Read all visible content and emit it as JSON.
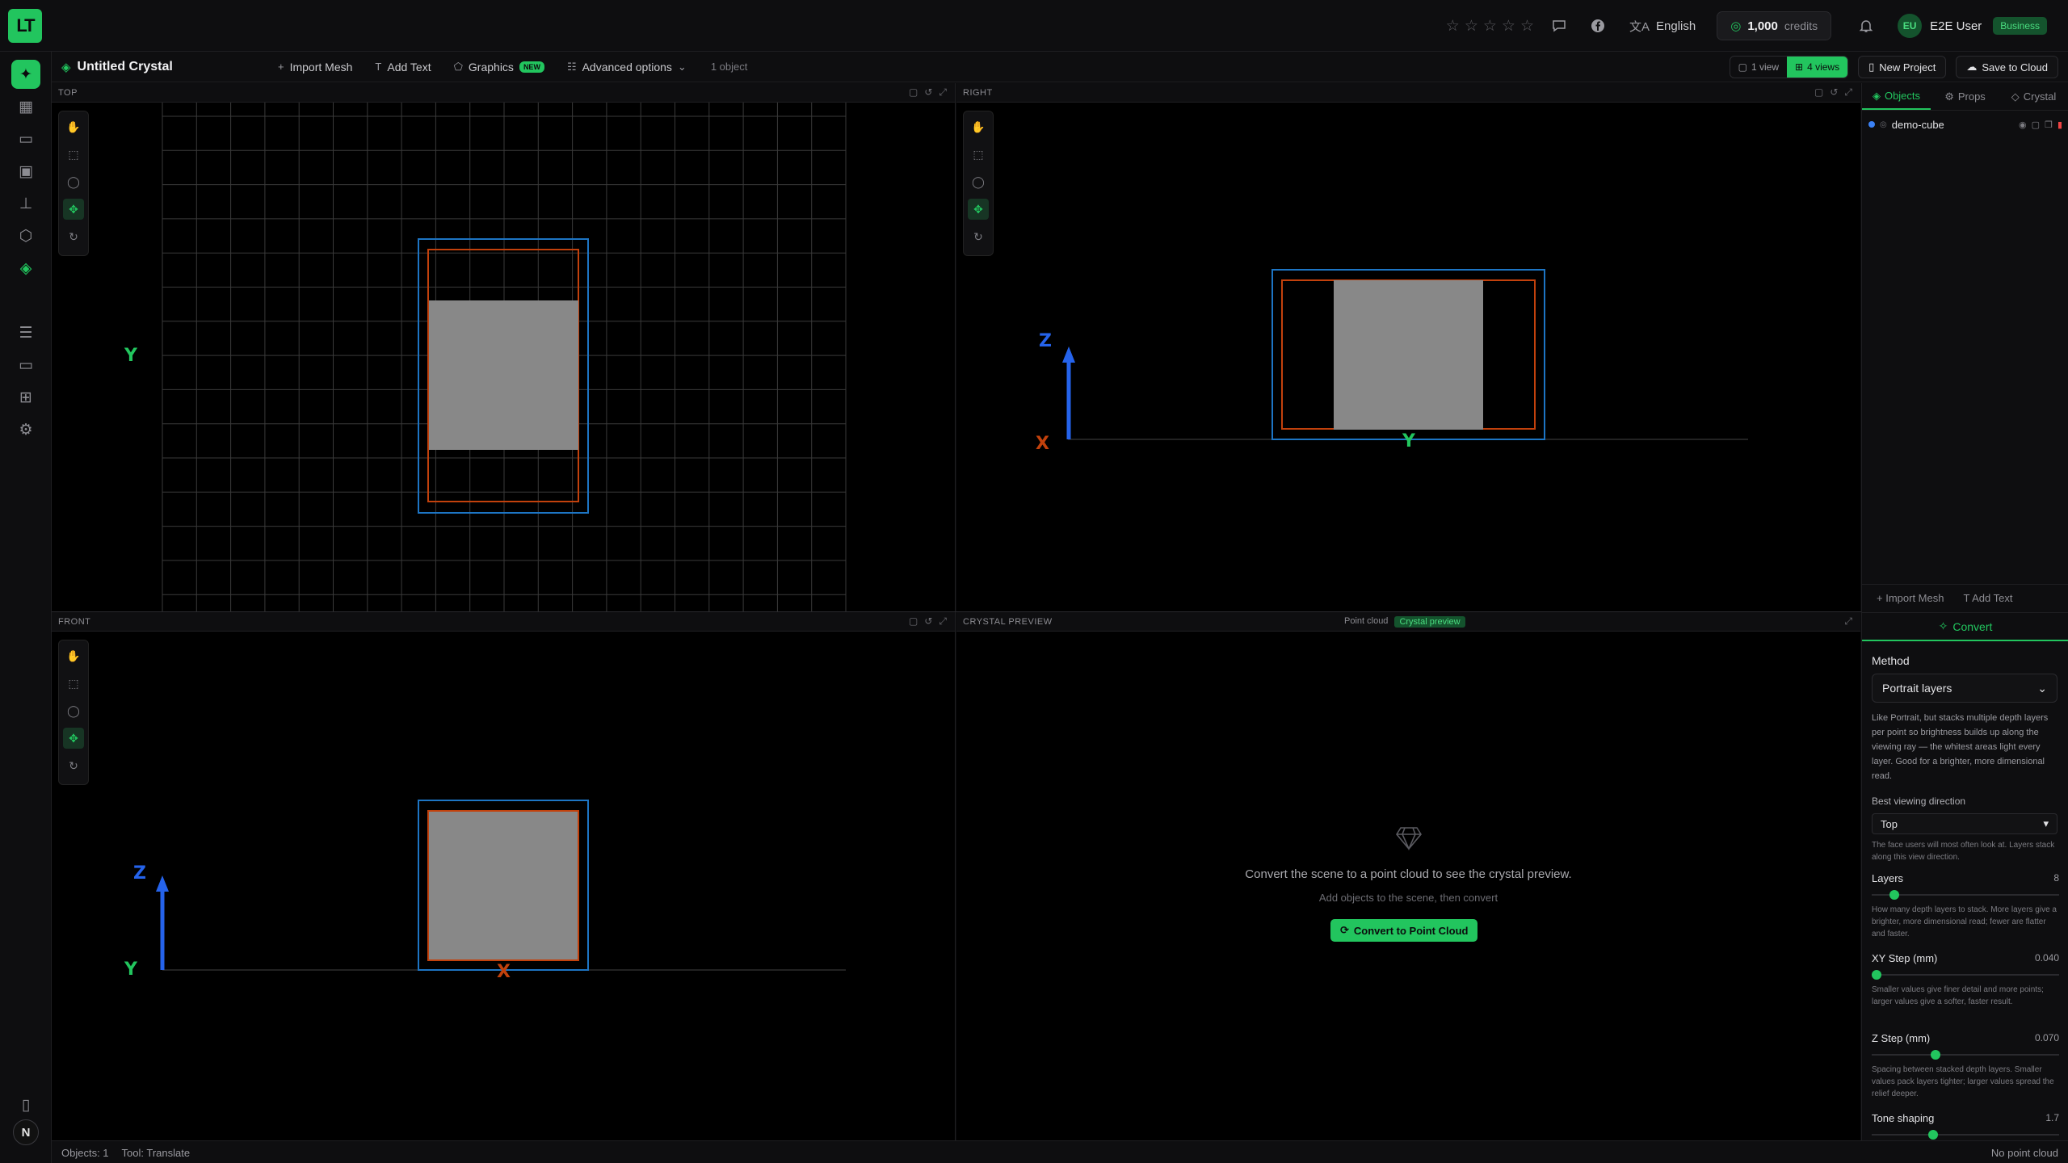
{
  "app": {
    "logo_text": "LT"
  },
  "topbar": {
    "stars": [
      "☆",
      "☆",
      "☆",
      "☆",
      "☆"
    ],
    "language": "English",
    "credits_value": "1,000",
    "credits_label": "credits",
    "user_initials": "EU",
    "user_name": "E2E User",
    "plan": "Business"
  },
  "toolbar": {
    "project_title": "Untitled Crystal",
    "import_mesh": "Import Mesh",
    "add_text": "Add Text",
    "graphics": "Graphics",
    "new_badge": "NEW",
    "advanced": "Advanced options",
    "object_count": "1 object",
    "view_one": "1 view",
    "view_four": "4 views",
    "new_project": "New Project",
    "save_cloud": "Save to Cloud"
  },
  "viewports": {
    "top": {
      "label": "TOP",
      "axis_y": "Y"
    },
    "right": {
      "label": "RIGHT",
      "axis_z": "Z",
      "axis_x": "X",
      "axis_y": "Y"
    },
    "front": {
      "label": "FRONT",
      "axis_z": "Z",
      "axis_y": "Y",
      "axis_x": "X"
    },
    "crystal": {
      "label": "CRYSTAL PREVIEW",
      "toggle_a": "Point cloud",
      "toggle_b": "Crystal preview",
      "message": "Convert the scene to a point cloud to see the crystal preview.",
      "sub": "Add objects to the scene, then convert",
      "button": "Convert to Point Cloud"
    }
  },
  "panel": {
    "tabs": [
      "Objects",
      "Props",
      "Crystal"
    ],
    "object_name": "demo-cube",
    "import_mesh": "Import Mesh",
    "add_text": "Add Text",
    "convert": "Convert",
    "method_title": "Method",
    "method_value": "Portrait layers",
    "method_desc": "Like Portrait, but stacks multiple depth layers per point so brightness builds up along the viewing ray — the whitest areas light every layer. Good for a brighter, more dimensional read.",
    "view_dir_title": "Best viewing direction",
    "view_dir_value": "Top",
    "view_dir_desc": "The face users will most often look at. Layers stack along this view direction.",
    "layers_title": "Layers",
    "layers_value": "8",
    "layers_fraction": 0.1,
    "layers_desc": "How many depth layers to stack. More layers give a brighter, more dimensional read; fewer are flatter and faster.",
    "xy_title": "XY Step (mm)",
    "xy_value": "0.040",
    "xy_fraction": 0.0,
    "xy_desc": "Smaller values give finer detail and more points; larger values give a softer, faster result.",
    "z_title": "Z Step (mm)",
    "z_value": "0.070",
    "z_fraction": 0.33,
    "z_desc": "Spacing between stacked depth layers. Smaller values pack layers tighter; larger values spread the relief deeper.",
    "tone_title": "Tone shaping",
    "tone_value": "1.7",
    "tone_fraction": 0.32
  },
  "status": {
    "objects": "Objects: 1",
    "tool": "Tool: Translate",
    "right": "No point cloud"
  }
}
